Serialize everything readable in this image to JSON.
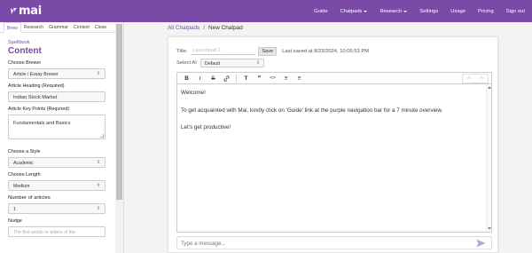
{
  "app": {
    "logo_text": "mai",
    "nav": [
      {
        "label": "Guide",
        "dropdown": false
      },
      {
        "label": "Chatpads",
        "dropdown": true
      },
      {
        "label": "Research",
        "dropdown": true
      },
      {
        "label": "Settings",
        "dropdown": false
      },
      {
        "label": "Usage",
        "dropdown": false
      },
      {
        "label": "Pricing",
        "dropdown": false
      },
      {
        "label": "Sign out",
        "dropdown": false
      }
    ],
    "accent_color": "#7a4ba6"
  },
  "sidebar": {
    "tabs": [
      "Brew",
      "Research",
      "Grammar",
      "Context",
      "Close"
    ],
    "active_tab": "Brew",
    "section_label": "Spellbook",
    "section_title": "Content",
    "brewer": {
      "label": "Choose Brewer",
      "value": "Article / Essay Brewer"
    },
    "heading": {
      "label": "Article Heading (Required)",
      "value": "Indian Stock Market"
    },
    "key_points": {
      "label": "Article Key Points (Required)",
      "value": "Fundamentals and Basics"
    },
    "style": {
      "label": "Choose a Style",
      "value": "Academic"
    },
    "length": {
      "label": "Choose Length",
      "value": "Medium"
    },
    "num_articles": {
      "label": "Number of articles",
      "value": "1"
    },
    "nudge": {
      "label": "Nudge",
      "placeholder": "The first words or letters of the"
    }
  },
  "breadcrumb": {
    "parent": "All Chatpads",
    "separator": "/",
    "current": "New Chatpad"
  },
  "chatpad": {
    "title_label": "Title:",
    "title_placeholder": "Launchpad 1",
    "save_label": "Save",
    "last_saved": "Last saved at 8/23/2024, 10:05:53 PM",
    "ai_label": "Select AI",
    "ai_value": "Default",
    "toolbar": [
      {
        "icon": "bold-icon",
        "glyph": "B"
      },
      {
        "icon": "italic-icon",
        "glyph": "I"
      },
      {
        "icon": "strikethrough-icon",
        "glyph": "S"
      },
      {
        "icon": "link-icon",
        "glyph": "🔗"
      },
      {
        "icon": "heading-icon",
        "glyph": "T"
      },
      {
        "icon": "quote-icon",
        "glyph": "❞"
      },
      {
        "icon": "code-icon",
        "glyph": "<>"
      },
      {
        "icon": "bullet-list-icon",
        "glyph": "≡"
      },
      {
        "icon": "numbered-list-icon",
        "glyph": "≡"
      }
    ],
    "undo_glyph": "↶",
    "redo_glyph": "↷",
    "editor_lines": [
      "Welcome!",
      "To get acquainted with Mai, kindly click on 'Guide' link at the purple navigation bar for a 7 minute overview.",
      "Let's get productive!"
    ],
    "message_placeholder": "Type a message..."
  }
}
